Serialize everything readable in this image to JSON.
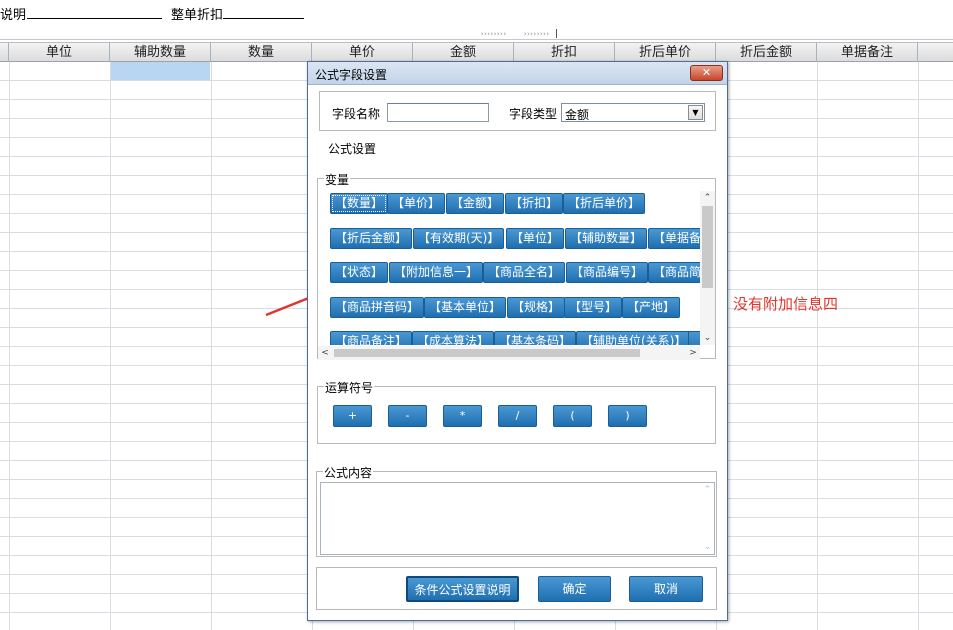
{
  "topbar": {
    "note_label": "说明",
    "discount_label": "整单折扣"
  },
  "grid": {
    "columns": [
      "单位",
      "辅助数量",
      "数量",
      "单价",
      "金额",
      "折扣",
      "折后单价",
      "折后金额",
      "单据备注"
    ]
  },
  "dialog": {
    "title": "公式字段设置",
    "close_symbol": "✕",
    "field_name_label": "字段名称",
    "field_name_value": "",
    "field_type_label": "字段类型",
    "field_type_value": "金额",
    "formula_settings_label": "公式设置",
    "variables_label": "变量",
    "variables": [
      "【数量】",
      "【单价】",
      "【金额】",
      "【折扣】",
      "【折后单价】",
      "【折后金额】",
      "【有效期(天)】",
      "【单位】",
      "【辅助数量】",
      "【单据备注】",
      "【状态】",
      "【附加信息一】",
      "【商品全名】",
      "【商品编号】",
      "【商品简名】",
      "【商品拼音码】",
      "【基本单位】",
      "【规格】",
      "【型号】",
      "【产地】",
      "【商品备注】",
      "【成本算法】",
      "【基本条码】",
      "【辅助单位(关系)】",
      "【"
    ],
    "operators_label": "运算符号",
    "operators": [
      "+",
      "-",
      "*",
      "/",
      "(",
      ")"
    ],
    "formula_content_label": "公式内容",
    "formula_content_value": "",
    "buttons": {
      "help": "条件公式设置说明",
      "ok": "确定",
      "cancel": "取消"
    }
  },
  "annotation": {
    "text": "没有附加信息四",
    "color": "#e0352b"
  },
  "colors": {
    "button_blue": "#2b7fc0",
    "selected_cell": "#b8d6f2"
  },
  "icons": {
    "dropdown": "chevron-down-icon",
    "close": "close-icon",
    "scroll_up": "arrow-up-icon",
    "scroll_down": "arrow-down-icon"
  }
}
